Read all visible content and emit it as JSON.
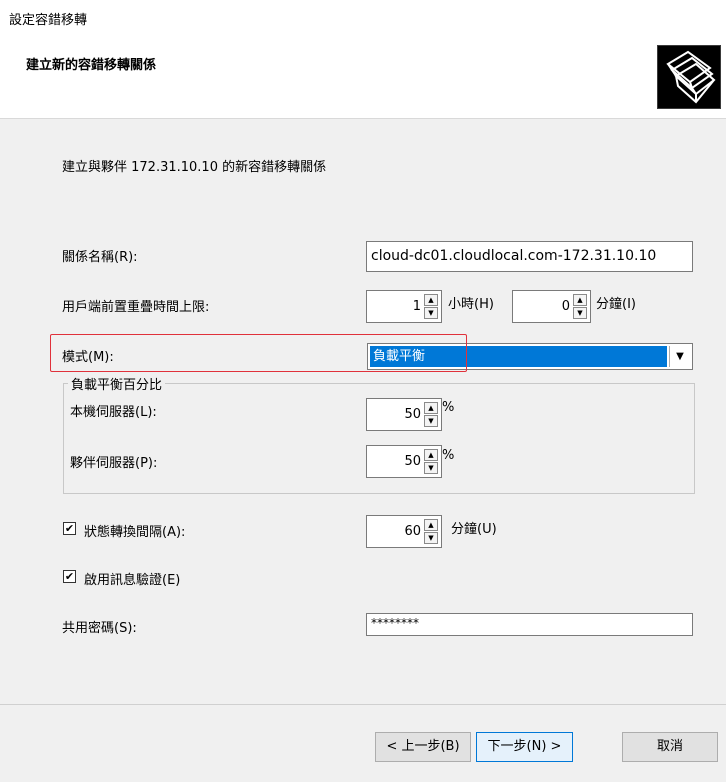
{
  "window": {
    "title": "設定容錯移轉"
  },
  "header": {
    "title": "建立新的容錯移轉關係"
  },
  "intro": "建立與夥伴 172.31.10.10 的新容錯移轉關係",
  "fields": {
    "relationship_name": {
      "label": "關係名稱(R):",
      "value": "cloud-dc01.cloudlocal.com-172.31.10.10"
    },
    "mclt": {
      "label": "用戶端前置重疊時間上限:",
      "hours": "1",
      "hours_unit": "小時(H)",
      "minutes": "0",
      "minutes_unit": "分鐘(I)"
    },
    "mode": {
      "label": "模式(M):",
      "selected": "負載平衡"
    },
    "load_balance": {
      "group_title": "負載平衡百分比",
      "local_label": "本機伺服器(L):",
      "local_value": "50",
      "local_unit": "%",
      "partner_label": "夥伴伺服器(P):",
      "partner_value": "50",
      "partner_unit": "%"
    },
    "state_switch": {
      "label": "狀態轉換間隔(A):",
      "checked": true,
      "value": "60",
      "unit": "分鐘(U)"
    },
    "message_auth": {
      "label": "啟用訊息驗證(E)",
      "checked": true
    },
    "shared_secret": {
      "label": "共用密碼(S):",
      "value": "********"
    }
  },
  "buttons": {
    "back": "< 上一步(B)",
    "next": "下一步(N) >",
    "cancel": "取消"
  },
  "icons": {
    "wizard": "folders-icon",
    "check": "✔"
  }
}
